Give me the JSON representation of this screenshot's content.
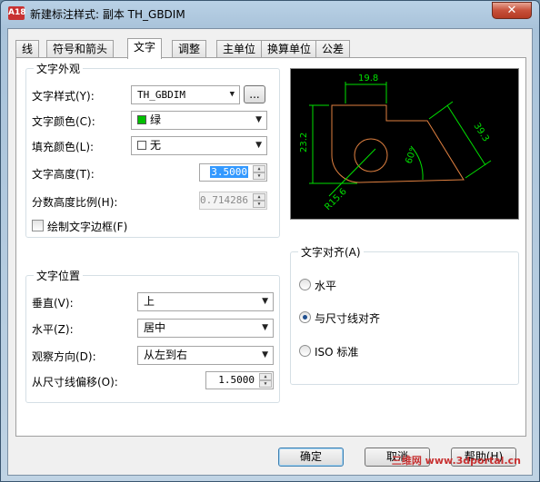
{
  "window": {
    "title": "新建标注样式: 副本 TH_GBDIM",
    "app_icon": "A18",
    "close_label": "✕"
  },
  "tabs": [
    {
      "label": "线",
      "active": false
    },
    {
      "label": "符号和箭头",
      "active": false
    },
    {
      "label": "文字",
      "active": true
    },
    {
      "label": "调整",
      "active": false
    },
    {
      "label": "主单位",
      "active": false
    },
    {
      "label": "换算单位",
      "active": false
    },
    {
      "label": "公差",
      "active": false
    }
  ],
  "appearance": {
    "title": "文字外观",
    "style_label": "文字样式(Y):",
    "style_value": "TH_GBDIM",
    "style_browse": "...",
    "color_label": "文字颜色(C):",
    "color_value": "绿",
    "color_swatch": "#00c000",
    "fill_label": "填充颜色(L):",
    "fill_value": "无",
    "height_label": "文字高度(T):",
    "height_value": "3.5000",
    "fraction_label": "分数高度比例(H):",
    "fraction_value": "0.714286",
    "frame_label": "绘制文字边框(F)"
  },
  "placement": {
    "title": "文字位置",
    "vertical_label": "垂直(V):",
    "vertical_value": "上",
    "horizontal_label": "水平(Z):",
    "horizontal_value": "居中",
    "view_label": "观察方向(D):",
    "view_value": "从左到右",
    "offset_label": "从尺寸线偏移(O):",
    "offset_value": "1.5000"
  },
  "alignment": {
    "title": "文字对齐(A)",
    "options": [
      {
        "label": "水平",
        "selected": false
      },
      {
        "label": "与尺寸线对齐",
        "selected": true
      },
      {
        "label": "ISO 标准",
        "selected": false
      }
    ]
  },
  "preview": {
    "dim_top": "19.8",
    "dim_left": "23.2",
    "dim_right": "39.3",
    "dim_angle": "60°",
    "dim_radius": "R15.6",
    "dim_color": "#00e000",
    "geom_color": "#e08040",
    "text_color": "#ffffff"
  },
  "footer": {
    "ok": "确定",
    "cancel": "取消",
    "help": "帮助(H)"
  },
  "watermark": "三维网 www.3dportal.cn"
}
